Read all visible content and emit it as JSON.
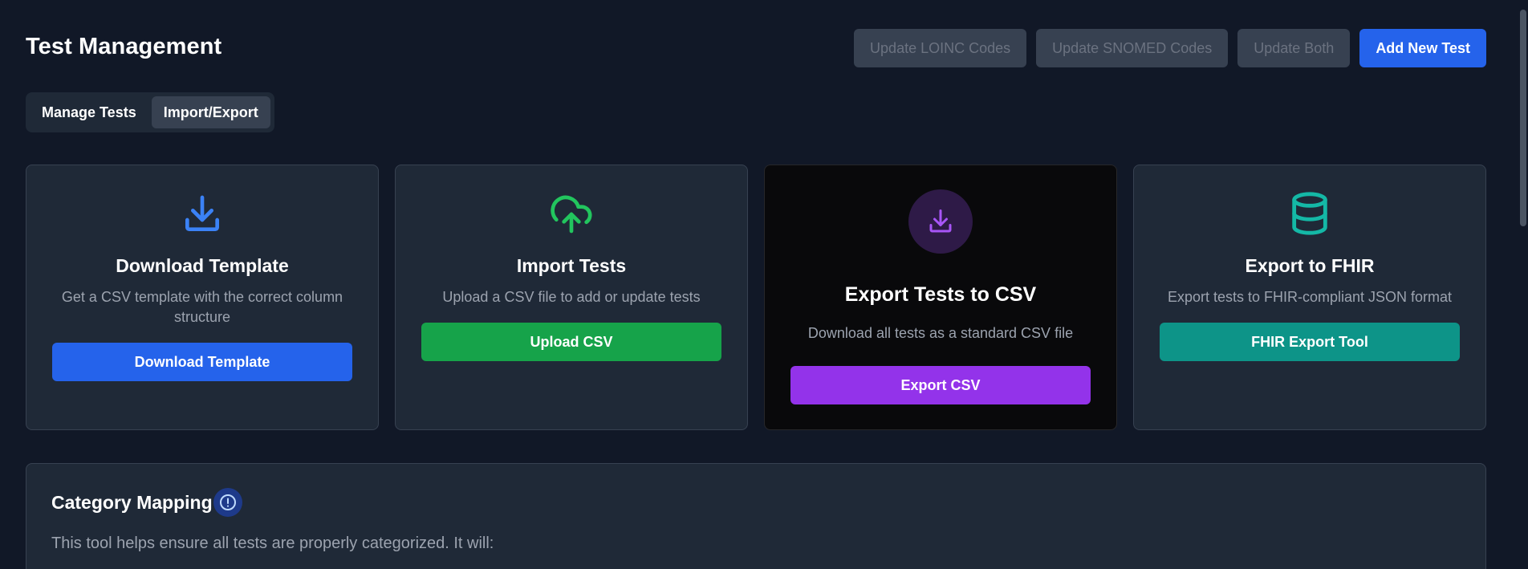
{
  "header": {
    "title": "Test Management",
    "buttons": {
      "update_loinc": "Update LOINC Codes",
      "update_snomed": "Update SNOMED Codes",
      "update_both": "Update Both",
      "add_new": "Add New Test"
    }
  },
  "tabs": [
    {
      "label": "Manage Tests",
      "active": false
    },
    {
      "label": "Import/Export",
      "active": true
    }
  ],
  "cards": [
    {
      "title": "Download Template",
      "description": "Get a CSV template with the correct column structure",
      "button": "Download Template",
      "icon": "download-icon",
      "accent": "#3b82f6"
    },
    {
      "title": "Import Tests",
      "description": "Upload a CSV file to add or update tests",
      "button": "Upload CSV",
      "icon": "cloud-upload-icon",
      "accent": "#22c55e"
    },
    {
      "title": "Export Tests to CSV",
      "description": "Download all tests as a standard CSV file",
      "button": "Export CSV",
      "icon": "download-icon",
      "accent": "#a855f7"
    },
    {
      "title": "Export to FHIR",
      "description": "Export tests to FHIR-compliant JSON format",
      "button": "FHIR Export Tool",
      "icon": "database-icon",
      "accent": "#14b8a6"
    }
  ],
  "mapping": {
    "title": "Category Mapping",
    "info_icon": "info-icon",
    "description": "This tool helps ensure all tests are properly categorized. It will:"
  },
  "colors": {
    "background": "#111827",
    "card": "#1f2937",
    "primary": "#2563eb",
    "disabled_button": "#374151"
  }
}
